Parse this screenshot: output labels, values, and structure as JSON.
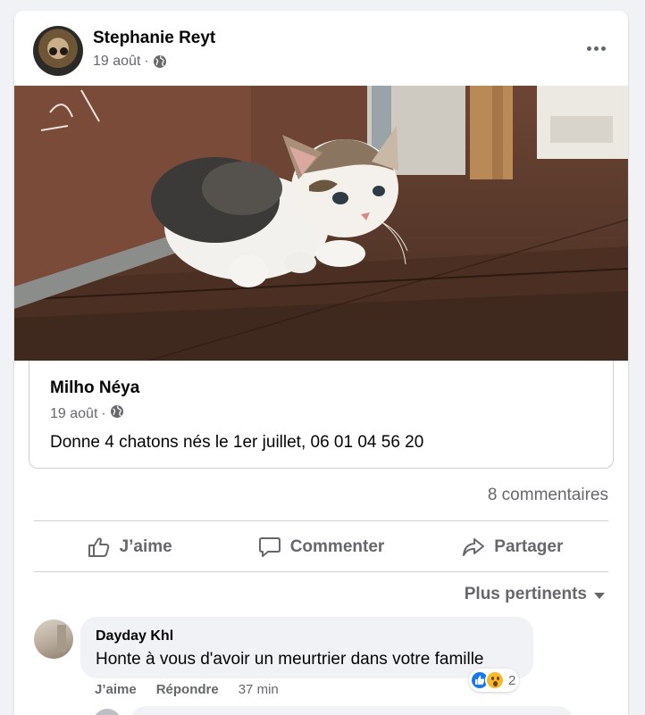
{
  "post": {
    "author": "Stephanie Reyt",
    "date": "19 août",
    "separator": "·"
  },
  "shared": {
    "author": "Milho Néya",
    "date": "19 août",
    "separator": "·",
    "text": "Donne 4 chatons nés le 1er juillet, 06 01 04 56 20"
  },
  "stats": {
    "comments": "8 commentaires"
  },
  "actions": {
    "like": "J’aime",
    "comment": "Commenter",
    "share": "Partager"
  },
  "sort": {
    "label": "Plus pertinents"
  },
  "comment": {
    "author": "Dayday Khl",
    "text": "Honte à vous d'avoir un meurtrier dans votre famille",
    "like_label": "J’aime",
    "reply_label": "Répondre",
    "time": "37 min",
    "reaction_count": "2",
    "reaction_icons": [
      "like-icon",
      "wow-icon"
    ]
  },
  "colors": {
    "brand_blue": "#1877f2",
    "secondary_text": "#65676b",
    "background": "#f0f2f5"
  }
}
